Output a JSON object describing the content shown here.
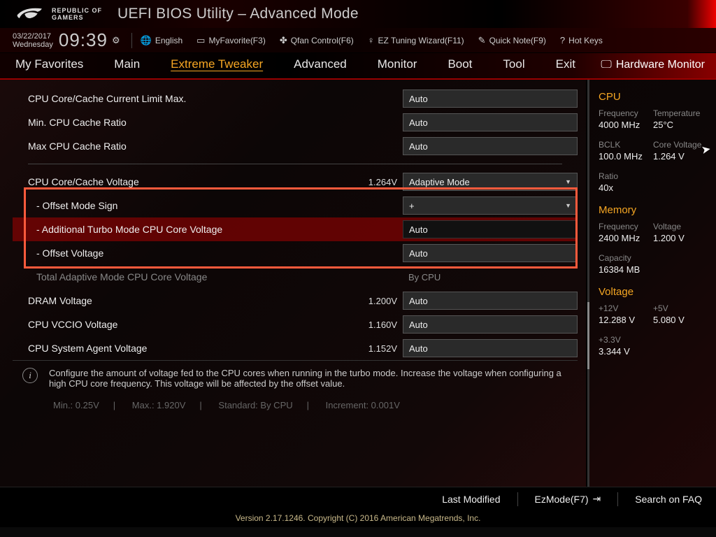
{
  "brand": {
    "line1": "REPUBLIC OF",
    "line2": "GAMERS"
  },
  "title": "UEFI BIOS Utility – Advanced Mode",
  "date": "03/22/2017",
  "weekday": "Wednesday",
  "clock": "09:39",
  "toolbar": {
    "language": "English",
    "favorite": "MyFavorite(F3)",
    "qfan": "Qfan Control(F6)",
    "eztune": "EZ Tuning Wizard(F11)",
    "quicknote": "Quick Note(F9)",
    "hotkeys": "Hot Keys"
  },
  "tabs": [
    "My Favorites",
    "Main",
    "Extreme Tweaker",
    "Advanced",
    "Monitor",
    "Boot",
    "Tool",
    "Exit"
  ],
  "active_tab": "Extreme Tweaker",
  "hw_header": "Hardware Monitor",
  "settings": {
    "r1": {
      "label": "CPU Core/Cache Current Limit Max.",
      "value": "Auto"
    },
    "r2": {
      "label": "Min. CPU Cache Ratio",
      "value": "Auto"
    },
    "r3": {
      "label": "Max CPU Cache Ratio",
      "value": "Auto"
    },
    "r4": {
      "label": "CPU Core/Cache Voltage",
      "readout": "1.264V",
      "value": "Adaptive Mode"
    },
    "r5": {
      "label": "- Offset Mode Sign",
      "value": "+"
    },
    "r6": {
      "label": "- Additional Turbo Mode CPU Core Voltage",
      "value": "Auto"
    },
    "r7": {
      "label": "- Offset Voltage",
      "value": "Auto"
    },
    "r8": {
      "label": "Total Adaptive Mode CPU Core Voltage",
      "value": "By CPU"
    },
    "r9": {
      "label": "DRAM Voltage",
      "readout": "1.200V",
      "value": "Auto"
    },
    "r10": {
      "label": "CPU VCCIO Voltage",
      "readout": "1.160V",
      "value": "Auto"
    },
    "r11": {
      "label": "CPU System Agent Voltage",
      "readout": "1.152V",
      "value": "Auto"
    }
  },
  "help_text": "Configure the amount of voltage fed to the CPU cores when running in the turbo mode. Increase the voltage when configuring a high CPU core frequency. This voltage will be affected by the offset value.",
  "range": {
    "min": "Min.: 0.25V",
    "max": "Max.: 1.920V",
    "std": "Standard: By CPU",
    "inc": "Increment: 0.001V"
  },
  "hw": {
    "cpu_title": "CPU",
    "freq_l": "Frequency",
    "freq_v": "4000 MHz",
    "temp_l": "Temperature",
    "temp_v": "25°C",
    "bclk_l": "BCLK",
    "bclk_v": "100.0 MHz",
    "corev_l": "Core Voltage",
    "corev_v": "1.264 V",
    "ratio_l": "Ratio",
    "ratio_v": "40x",
    "mem_title": "Memory",
    "mfreq_l": "Frequency",
    "mfreq_v": "2400 MHz",
    "mvolt_l": "Voltage",
    "mvolt_v": "1.200 V",
    "cap_l": "Capacity",
    "cap_v": "16384 MB",
    "volt_title": "Voltage",
    "v12_l": "+12V",
    "v12_v": "12.288 V",
    "v5_l": "+5V",
    "v5_v": "5.080 V",
    "v33_l": "+3.3V",
    "v33_v": "3.344 V"
  },
  "footer": {
    "last": "Last Modified",
    "ez": "EzMode(F7)",
    "faq": "Search on FAQ"
  },
  "copyright": "Version 2.17.1246. Copyright (C) 2016 American Megatrends, Inc."
}
